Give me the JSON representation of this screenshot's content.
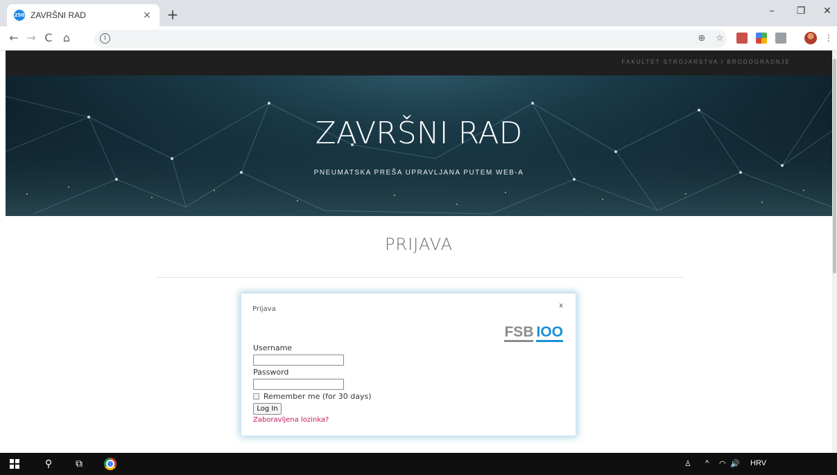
{
  "browser": {
    "tab": {
      "favicon_text": "250",
      "title": "ZAVRŠNI RAD",
      "close": "×"
    },
    "new_tab": "+",
    "window": {
      "minimize": "–",
      "restore": "❐",
      "close": "✕"
    },
    "nav": {
      "back": "←",
      "forward": "→",
      "reload": "C",
      "home": "⌂"
    },
    "info_icon": "i",
    "toolbar_icons": {
      "zoom": "⊕",
      "star": "☆",
      "menu": "⋮"
    }
  },
  "site": {
    "topbar_text": "FAKULTET STROJARSTVA I BRODOGRADNJE",
    "hero_title": "ZAVRŠNI RAD",
    "hero_subtitle": "PNEUMATSKA PREŠA UPRAVLJANA PUTEM WEB-A",
    "heading": "PRIJAVA"
  },
  "dialog": {
    "title": "Prijava",
    "close": "x",
    "logo": {
      "left": "FSB",
      "right": "IOO"
    },
    "username_label": "Username",
    "username_value": "",
    "password_label": "Password",
    "password_value": "",
    "remember_label": "Remember me (for 30 days)",
    "login_button": "Log In",
    "forgot_link": "Zaboravljena lozinka?"
  },
  "taskbar": {
    "search_icon": "⚲",
    "taskview_icon": "⧉",
    "tray_chevron": "^",
    "tray_audio": "🔊",
    "language": "HRV"
  },
  "colors": {
    "accent_link": "#c2185b",
    "logo_blue": "#1a8fd6",
    "logo_gray": "#8c8c8c",
    "topbar": "#1f1f1f"
  }
}
